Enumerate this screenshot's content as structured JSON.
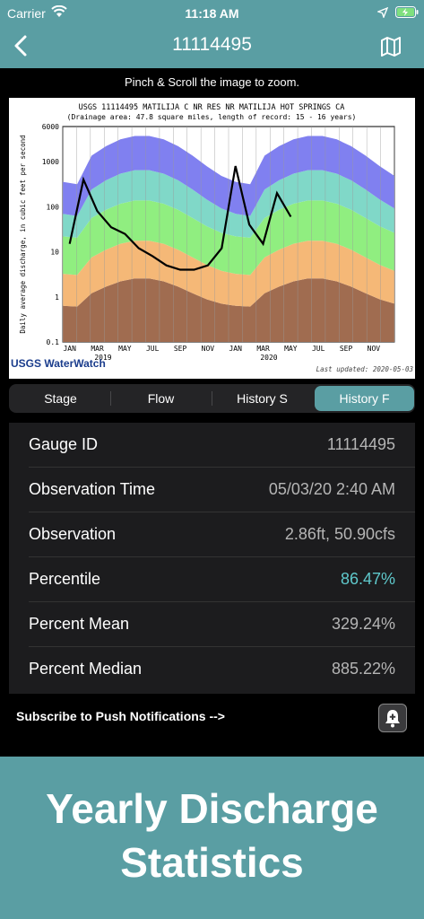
{
  "status": {
    "carrier": "Carrier",
    "time": "11:18 AM",
    "location_icon": "location-arrow-icon",
    "battery_icon": "battery-charging-icon"
  },
  "nav": {
    "title": "11114495",
    "back_icon": "chevron-left-icon",
    "map_icon": "map-icon"
  },
  "zoom_hint": "Pinch & Scroll the image to zoom.",
  "chart_data": {
    "type": "area",
    "title": "USGS 11114495 MATILIJA C NR RES NR MATILIJA HOT SPRINGS CA",
    "subtitle": "(Drainage area: 47.8 square miles, length of record: 15 - 16 years)",
    "ylabel": "Daily average discharge, in cubic feet per second",
    "yscale": "log",
    "ylim": [
      0.1,
      6000
    ],
    "yticks": [
      "6000",
      "1000",
      "100",
      "10",
      "1",
      "0.1"
    ],
    "xticks": [
      "JAN",
      "MAR",
      "MAY",
      "JUL",
      "SEP",
      "NOV",
      "JAN",
      "MAR",
      "MAY",
      "JUL",
      "SEP",
      "NOV"
    ],
    "year_labels": [
      "2019",
      "2020"
    ],
    "logo": "USGS WaterWatch",
    "updated": "Last updated: 2020-05-03",
    "band_colors": [
      "#a06c50",
      "#f5b877",
      "#90ee80",
      "#80d8c8",
      "#8080f0"
    ],
    "series": [
      {
        "name": "daily discharge",
        "x": [
          "JAN",
          "FEB",
          "MAR",
          "APR",
          "MAY",
          "JUN",
          "JUL",
          "AUG",
          "SEP",
          "OCT",
          "NOV",
          "DEC",
          "JAN",
          "FEB",
          "MAR",
          "APR",
          "MAY"
        ],
        "values": [
          15,
          400,
          80,
          35,
          25,
          12,
          8,
          5,
          4,
          4,
          5,
          12,
          800,
          40,
          15,
          200,
          60
        ]
      }
    ]
  },
  "tabs": [
    {
      "label": "Stage",
      "active": false
    },
    {
      "label": "Flow",
      "active": false
    },
    {
      "label": "History S",
      "active": false
    },
    {
      "label": "History F",
      "active": true
    }
  ],
  "rows": [
    {
      "label": "Gauge ID",
      "value": "11114495"
    },
    {
      "label": "Observation Time",
      "value": "05/03/20 2:40 AM"
    },
    {
      "label": "Observation",
      "value": "2.86ft, 50.90cfs"
    },
    {
      "label": "Percentile",
      "value": "86.47%"
    },
    {
      "label": "Percent Mean",
      "value": "329.24%"
    },
    {
      "label": "Percent Median",
      "value": "885.22%"
    }
  ],
  "subscribe": {
    "label": "Subscribe to Push Notifications -->",
    "icon": "bell-plus-icon"
  },
  "promo": {
    "line1": "Yearly Discharge",
    "line2": "Statistics"
  }
}
